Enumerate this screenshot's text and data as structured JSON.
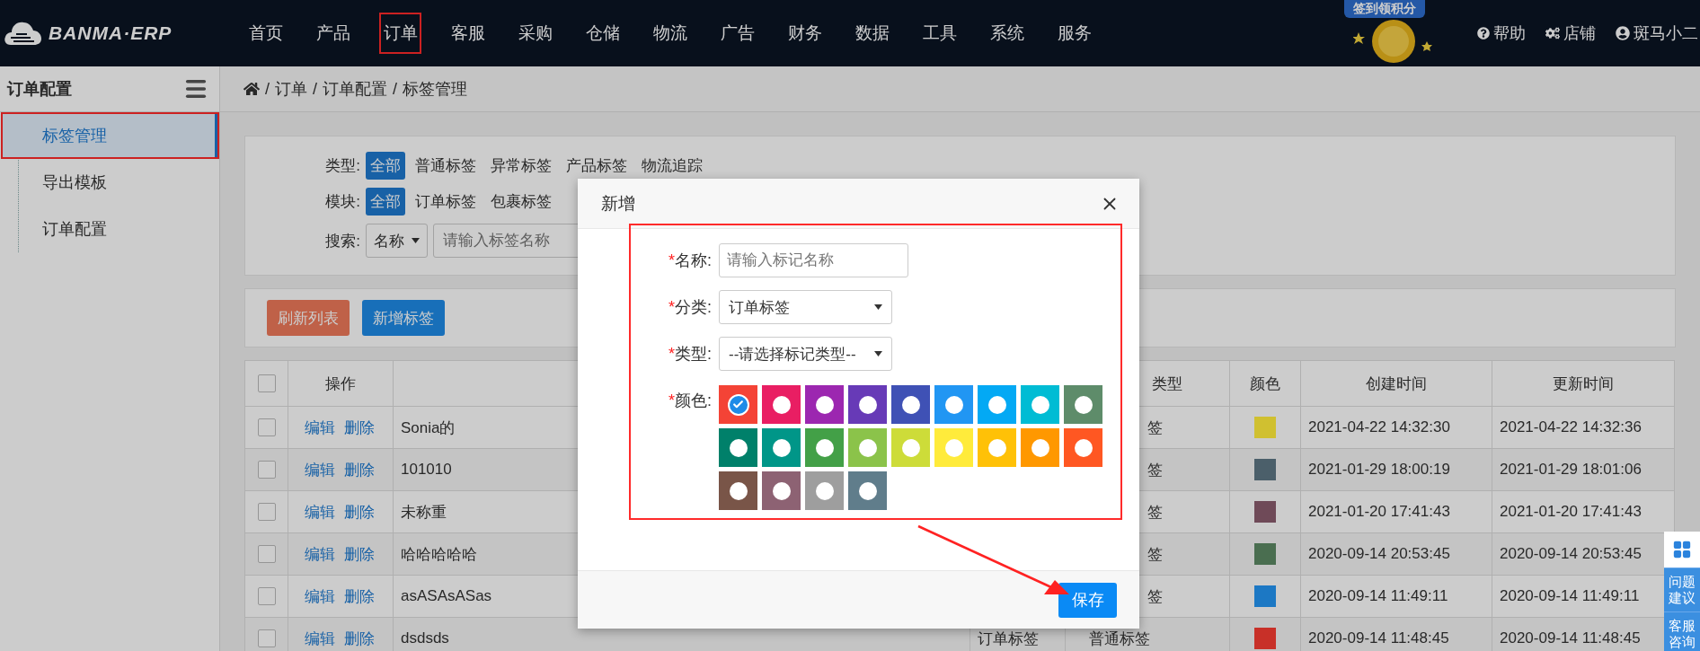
{
  "top_bar": {
    "logo": "BANMA·ERP",
    "nav": [
      {
        "label": "首页",
        "selected": false
      },
      {
        "label": "产品",
        "selected": false
      },
      {
        "label": "订单",
        "selected": true
      },
      {
        "label": "客服",
        "selected": false
      },
      {
        "label": "采购",
        "selected": false
      },
      {
        "label": "仓储",
        "selected": false
      },
      {
        "label": "物流",
        "selected": false
      },
      {
        "label": "广告",
        "selected": false
      },
      {
        "label": "财务",
        "selected": false
      },
      {
        "label": "数据",
        "selected": false
      },
      {
        "label": "工具",
        "selected": false
      },
      {
        "label": "系统",
        "selected": false
      },
      {
        "label": "服务",
        "selected": false
      }
    ],
    "signin_badge": "签到领积分",
    "help": "帮助",
    "shop": "店铺",
    "user": "斑马小二"
  },
  "sidebar": {
    "title": "订单配置",
    "items": [
      {
        "label": "标签管理",
        "selected": true
      },
      {
        "label": "导出模板",
        "selected": false
      },
      {
        "label": "订单配置",
        "selected": false
      }
    ]
  },
  "breadcrumb": [
    "订单",
    "订单配置",
    "标签管理"
  ],
  "breadcrumb_separator": "/",
  "filters": [
    {
      "label": "类型:",
      "options": [
        {
          "label": "全部",
          "selected": true
        },
        {
          "label": "普通标签",
          "selected": false
        },
        {
          "label": "异常标签",
          "selected": false
        },
        {
          "label": "产品标签",
          "selected": false
        },
        {
          "label": "物流追踪",
          "selected": false
        }
      ]
    },
    {
      "label": "模块:",
      "options": [
        {
          "label": "全部",
          "selected": true
        },
        {
          "label": "订单标签",
          "selected": false
        },
        {
          "label": "包裹标签",
          "selected": false
        }
      ]
    }
  ],
  "search": {
    "label": "搜索:",
    "field": "名称",
    "placeholder": "请输入标签名称"
  },
  "actions": [
    {
      "kind": "refresh",
      "label": "刷新列表"
    },
    {
      "kind": "add",
      "label": "新增标签"
    }
  ],
  "table": {
    "all_checked": false,
    "headers": {
      "actions": "操作",
      "type": "类型",
      "swatch": "颜色",
      "created": "创建时间",
      "updated": "更新时间"
    },
    "rows": [
      {
        "checked": false,
        "actions": [
          "编辑",
          "删除"
        ],
        "name": "Sonia的",
        "type": "签",
        "color": "#d0c030",
        "created": "2021-04-22 14:32:30",
        "updated": "2021-04-22 14:32:36"
      },
      {
        "checked": false,
        "actions": [
          "编辑",
          "删除"
        ],
        "name": "101010",
        "type": "签",
        "color": "#4b5f6a",
        "created": "2021-01-29 18:00:19",
        "updated": "2021-01-29 18:01:06"
      },
      {
        "checked": false,
        "actions": [
          "编辑",
          "删除"
        ],
        "name": "未称重",
        "type": "签",
        "color": "#6f4a58",
        "created": "2021-01-20 17:41:43",
        "updated": "2021-01-20 17:41:43"
      },
      {
        "checked": false,
        "actions": [
          "编辑",
          "删除"
        ],
        "name": "哈哈哈哈哈",
        "type": "签",
        "color": "#4a6e50",
        "created": "2020-09-14 20:53:45",
        "updated": "2020-09-14 20:53:45"
      },
      {
        "checked": false,
        "actions": [
          "编辑",
          "删除"
        ],
        "name": "asASAsASas",
        "type": "签",
        "color": "#1c78c4",
        "created": "2020-09-14 11:49:11",
        "updated": "2020-09-14 11:49:11"
      },
      {
        "checked": false,
        "actions": [
          "编辑",
          "删除"
        ],
        "name": "dsdsds",
        "module": "订单标签",
        "type": "普通标签",
        "color": "#c83028",
        "created": "2020-09-14 11:48:45",
        "updated": "2020-09-14 11:48:45"
      }
    ]
  },
  "help_widget": [
    "问题建议",
    "客服咨询"
  ],
  "dialog": {
    "title": "新增",
    "highlighted": true,
    "arrow": true,
    "required_mark": "*",
    "fields": [
      {
        "kind": "text",
        "label": "名称:",
        "placeholder": "请输入标记名称"
      },
      {
        "kind": "select",
        "label": "分类:",
        "value": "订单标签"
      },
      {
        "kind": "select",
        "label": "类型:",
        "value": "--请选择标记类型--"
      },
      {
        "kind": "colors",
        "label": "颜色:",
        "colors": [
          {
            "color": "#f44336",
            "selected": true
          },
          {
            "color": "#e91e63",
            "selected": false
          },
          {
            "color": "#9c27b0",
            "selected": false
          },
          {
            "color": "#673ab7",
            "selected": false
          },
          {
            "color": "#3f51b5",
            "selected": false
          },
          {
            "color": "#2196f3",
            "selected": false
          },
          {
            "color": "#03a9f4",
            "selected": false
          },
          {
            "color": "#00bcd4",
            "selected": false
          },
          {
            "color": "#5e8c6a",
            "selected": false
          },
          {
            "color": "#00806a",
            "selected": false
          },
          {
            "color": "#009688",
            "selected": false
          },
          {
            "color": "#43a047",
            "selected": false
          },
          {
            "color": "#8bc34a",
            "selected": false
          },
          {
            "color": "#cddc39",
            "selected": false
          },
          {
            "color": "#ffeb3b",
            "selected": false
          },
          {
            "color": "#ffc107",
            "selected": false
          },
          {
            "color": "#ff9800",
            "selected": false
          },
          {
            "color": "#ff5722",
            "selected": false
          },
          {
            "color": "#795548",
            "selected": false
          },
          {
            "color": "#8d6273",
            "selected": false
          },
          {
            "color": "#9e9e9e",
            "selected": false
          },
          {
            "color": "#607d8b",
            "selected": false
          }
        ]
      }
    ],
    "save": "保存"
  }
}
